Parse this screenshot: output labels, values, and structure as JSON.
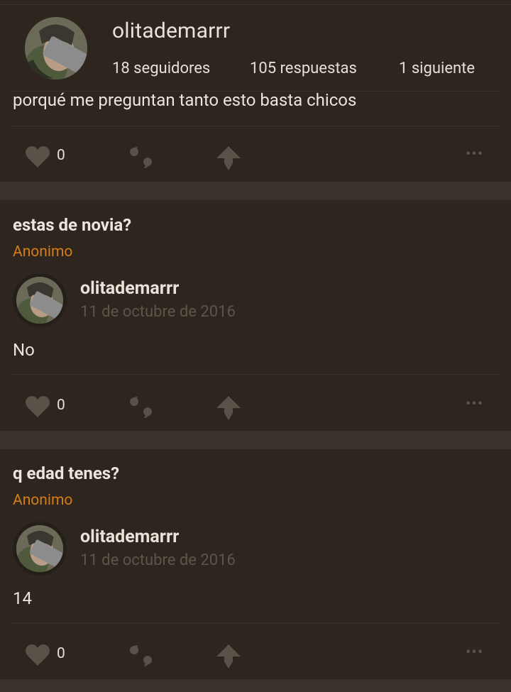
{
  "profile": {
    "username": "olitademarrr",
    "stats": [
      {
        "label": "18 seguidores"
      },
      {
        "label": "105 respuestas"
      },
      {
        "label": "1 siguiente"
      }
    ]
  },
  "posts": [
    {
      "answer": "porqué me preguntan tanto esto basta chicos",
      "likes": "0"
    },
    {
      "question": "estas de novia?",
      "asker": "Anonimo",
      "responder": "olitademarrr",
      "date": "11 de octubre de 2016",
      "answer": "No",
      "likes": "0"
    },
    {
      "question": "q edad tenes?",
      "asker": "Anonimo",
      "responder": "olitademarrr",
      "date": "11 de octubre de 2016",
      "answer": "14",
      "likes": "0"
    }
  ],
  "icons": {
    "like": "heart-icon",
    "quote": "quote-icon",
    "share": "share-arrow-icon",
    "more": "more-dots-icon"
  },
  "colors": {
    "background": "#2d251e",
    "separator": "#3a322a",
    "accent_anon": "#d47e18",
    "muted": "#5e554a"
  }
}
